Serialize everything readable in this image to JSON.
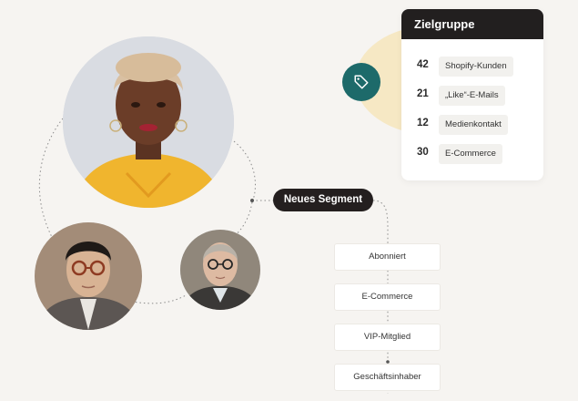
{
  "audience_panel": {
    "title": "Zielgruppe",
    "rows": [
      {
        "count": "42",
        "label": "Shopify-Kunden"
      },
      {
        "count": "21",
        "label": "„Like“-E-Mails"
      },
      {
        "count": "12",
        "label": "Medienkontakt"
      },
      {
        "count": "30",
        "label": "E-Commerce"
      }
    ]
  },
  "segment": {
    "label": "Neues Segment",
    "criteria": [
      "Abonniert",
      "E-Commerce",
      "VIP-Mitglied",
      "Geschäftsinhaber"
    ]
  },
  "icons": {
    "tag": "tag-icon"
  },
  "colors": {
    "background": "#f6f4f1",
    "tag_circle": "#1d6a6a",
    "dark": "#221f1f",
    "accent_blob": "#f6e8c4"
  }
}
